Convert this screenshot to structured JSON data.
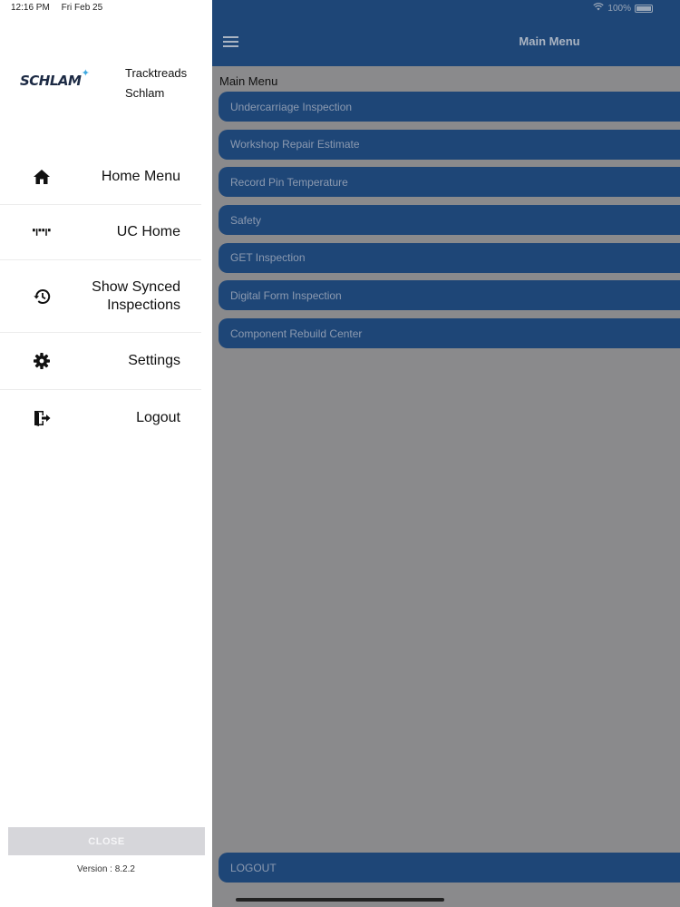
{
  "status": {
    "time": "12:16 PM",
    "date": "Fri Feb 25",
    "battery": "100%"
  },
  "header": {
    "title": "Main Menu"
  },
  "main": {
    "section_label": "Main Menu",
    "items": [
      {
        "label": "Undercarriage Inspection"
      },
      {
        "label": "Workshop Repair Estimate"
      },
      {
        "label": "Record Pin Temperature"
      },
      {
        "label": "Safety"
      },
      {
        "label": "GET Inspection"
      },
      {
        "label": "Digital Form Inspection"
      },
      {
        "label": "Component Rebuild Center"
      }
    ],
    "logout": "LOGOUT"
  },
  "drawer": {
    "logo_text": "SCHLAM",
    "user_line1": "Tracktreads",
    "user_line2": "Schlam",
    "nav": [
      {
        "label": "Home Menu",
        "icon": "home-icon"
      },
      {
        "label": "UC Home",
        "icon": "track-icon"
      },
      {
        "label": "Show Synced Inspections",
        "icon": "history-icon"
      },
      {
        "label": "Settings",
        "icon": "gear-icon"
      },
      {
        "label": "Logout",
        "icon": "logout-icon"
      }
    ],
    "close_label": "CLOSE",
    "version": "Version : 8.2.2"
  },
  "colors": {
    "primary": "#1e4677",
    "overlay": "#8a8a8c",
    "drawer_bg": "#ffffff"
  }
}
